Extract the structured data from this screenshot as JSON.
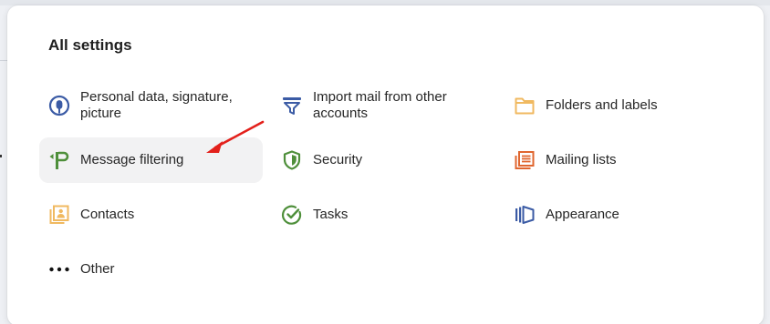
{
  "panel": {
    "title": "All settings"
  },
  "items": [
    {
      "label": "Personal data, signature, picture",
      "icon": "user-circle-icon",
      "color": "#3b5ba5"
    },
    {
      "label": "Import mail from other accounts",
      "icon": "funnel-import-icon",
      "color": "#3b5ba5"
    },
    {
      "label": "Folders and labels",
      "icon": "folder-icon",
      "color": "#f0b960"
    },
    {
      "label": "Message filtering",
      "icon": "filter-signpost-icon",
      "color": "#4e8f3a"
    },
    {
      "label": "Security",
      "icon": "shield-icon",
      "color": "#4e8f3a"
    },
    {
      "label": "Mailing lists",
      "icon": "mailing-list-icon",
      "color": "#e0662f"
    },
    {
      "label": "Contacts",
      "icon": "contacts-icon",
      "color": "#f0b960"
    },
    {
      "label": "Tasks",
      "icon": "check-circle-icon",
      "color": "#4e8f3a"
    },
    {
      "label": "Appearance",
      "icon": "appearance-icon",
      "color": "#3b5ba5"
    },
    {
      "label": "Other",
      "icon": "more-dots-icon",
      "color": "#111111"
    }
  ],
  "active_item": "Message filtering",
  "annotation_color": "#e3201b"
}
